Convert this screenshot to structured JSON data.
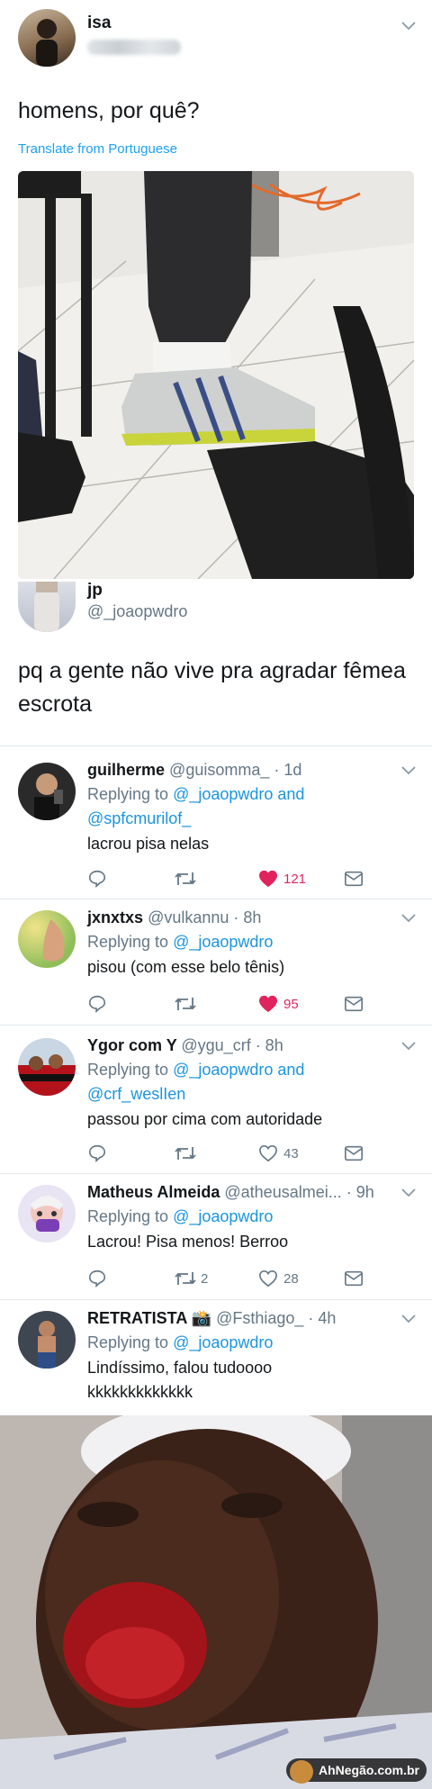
{
  "main_tweet": {
    "name": "isa",
    "handle": "@_________",
    "text": "homens, por quê?",
    "translate": "Translate from Portuguese"
  },
  "quote_tweet": {
    "name": "jp",
    "handle": "@_joaopwdro",
    "text_line1": "pq a gente não vive pra agradar fêmea",
    "text_line2": "escrota"
  },
  "replies": [
    {
      "name": "guilherme",
      "handle": "@guisomma_ · 1d",
      "replying_prefix": "Replying to ",
      "replying_to": "@_joaopwdro and",
      "replying_to_2": "@spfcmurilof_",
      "text": "lacrou pisa nelas",
      "retweets": "",
      "likes": "121",
      "liked": true
    },
    {
      "name": "jxnxtxs",
      "handle": "@vulkannu · 8h",
      "replying_prefix": "Replying to ",
      "replying_to": "@_joaopwdro",
      "text": "pisou (com esse belo tênis)",
      "retweets": "",
      "likes": "95",
      "liked": true
    },
    {
      "name": "Ygor com Y",
      "handle": "@ygu_crf · 8h",
      "replying_prefix": "Replying to ",
      "replying_to": "@_joaopwdro and",
      "replying_to_2": "@crf_weslIen",
      "text": "passou por cima com autoridade",
      "retweets": "",
      "likes": "43",
      "liked": false
    },
    {
      "name": "Matheus Almeida",
      "handle": "@atheusalmei... · 9h",
      "replying_prefix": "Replying to ",
      "replying_to": "@_joaopwdro",
      "text": "Lacrou! Pisa menos! Berroo",
      "retweets": "2",
      "likes": "28",
      "liked": false
    },
    {
      "name": "RETRATISTA 📸",
      "handle": "@Fsthiago_ · 4h",
      "replying_prefix": "Replying to ",
      "replying_to": "@_joaopwdro",
      "text": "Lindíssimo, falou tudoooo",
      "text_2": "kkkkkkkkkkkkk"
    }
  ],
  "watermark": "AhNegão.com.br",
  "colors": {
    "link_blue": "#1b95e0",
    "like_red": "#e0245e",
    "secondary_gray": "#657786"
  },
  "icons": [
    "reply-icon",
    "retweet-icon",
    "heart-icon",
    "dm-icon",
    "chevron-down-icon",
    "camera-emoji"
  ]
}
